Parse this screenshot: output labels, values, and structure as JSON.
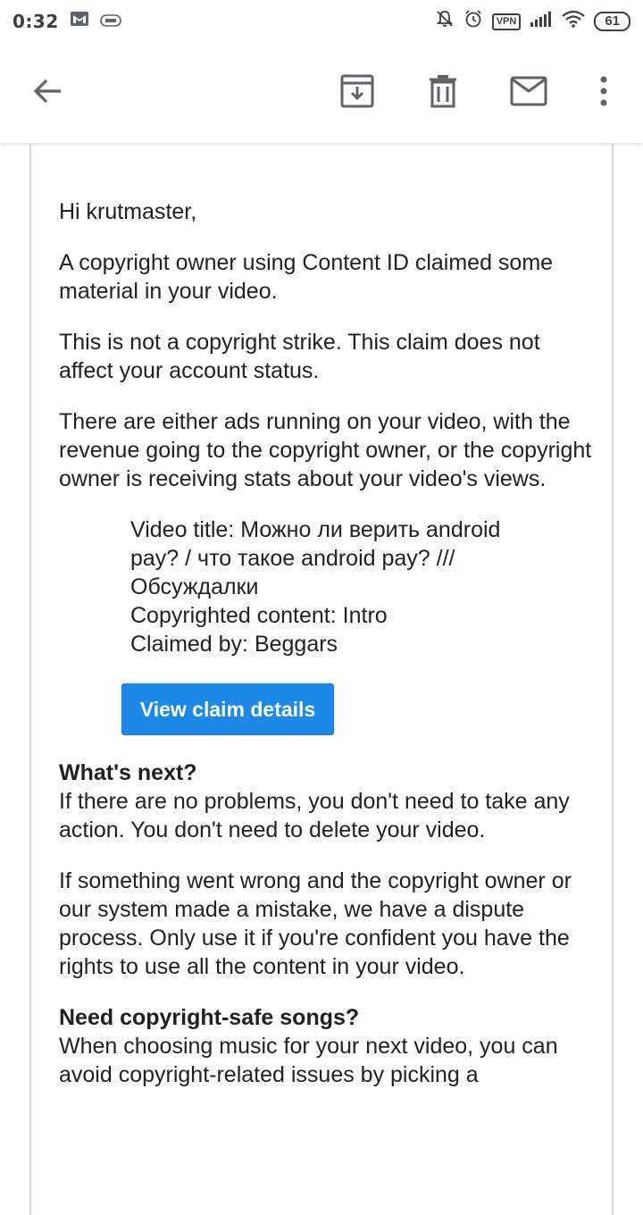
{
  "status_bar": {
    "time": "0:32",
    "vpn": "VPN",
    "battery": "61"
  },
  "toolbar": {
    "icons": [
      "back-arrow-icon",
      "archive-icon",
      "delete-icon",
      "mark-unread-icon",
      "more-vert-icon"
    ]
  },
  "email": {
    "greeting": "Hi krutmaster,",
    "para1": "A copyright owner using Content ID claimed some material in your video.",
    "para2": "This is not a copyright strike. This claim does not affect your account status.",
    "para3": "There are either ads running on your video, with the revenue going to the copyright owner, or the copyright owner is receiving stats about your video's views.",
    "details": {
      "video_title_line1": "Video title: Можно ли верить android",
      "video_title_line2": "pay? / что такое android pay? ///",
      "video_title_line3": "Обсуждалки",
      "copyrighted_content": "Copyrighted content: Intro",
      "claimed_by": "Claimed by: Beggars"
    },
    "button_label": "View claim details",
    "whats_next_heading": "What's next?",
    "whats_next_text": "If there are no problems, you don't need to take any action. You don't need to delete your video.",
    "dispute_text": "If something went wrong and the copyright owner or our system made a mistake, we have a dispute process. Only use it if you're confident you have the rights to use all the content in your video.",
    "songs_heading": "Need copyright-safe songs?",
    "songs_text": "When choosing music for your next video, you can avoid copyright-related issues by picking a"
  }
}
